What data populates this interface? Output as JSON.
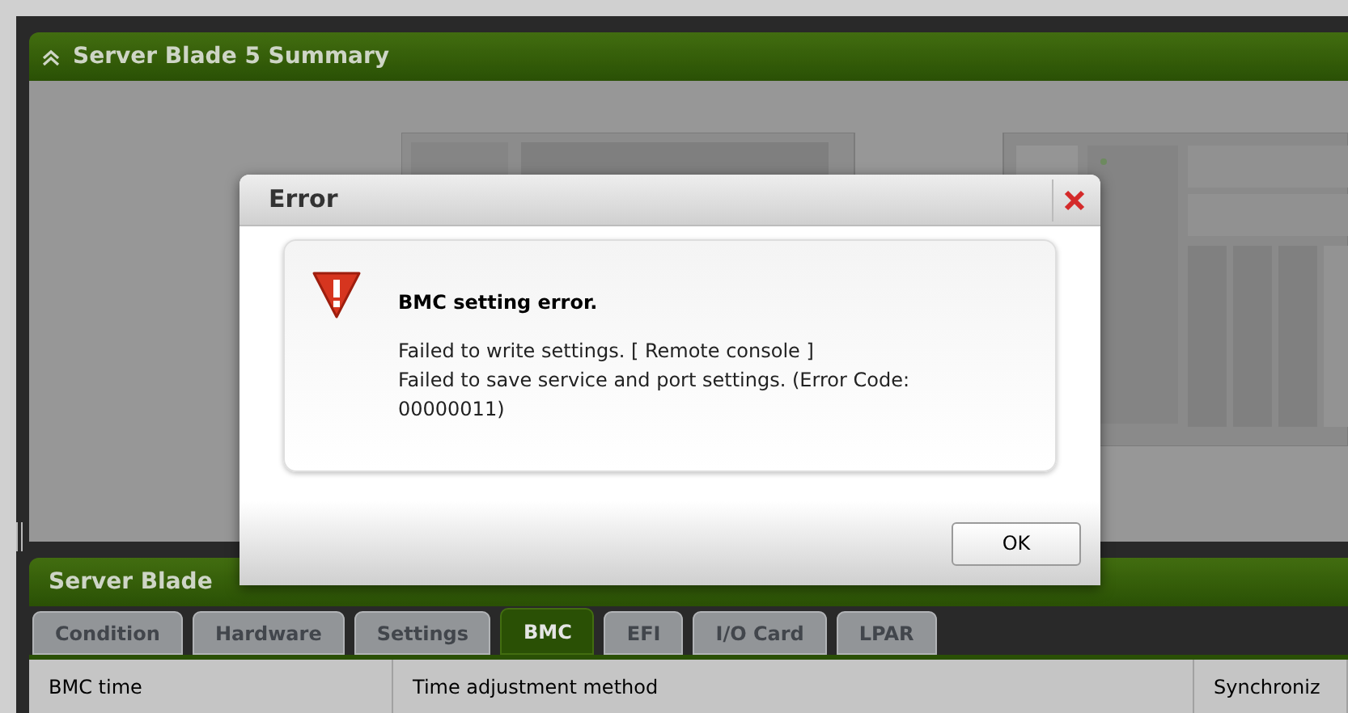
{
  "summary_panel": {
    "title": "Server Blade 5 Summary"
  },
  "info_panel": {
    "title": "Server Blade"
  },
  "tabs": [
    {
      "label": "Condition",
      "selected": false
    },
    {
      "label": "Hardware",
      "selected": false
    },
    {
      "label": "Settings",
      "selected": false
    },
    {
      "label": "BMC",
      "selected": true
    },
    {
      "label": "EFI",
      "selected": false
    },
    {
      "label": "I/O Card",
      "selected": false
    },
    {
      "label": "LPAR",
      "selected": false
    }
  ],
  "table": {
    "columns": [
      "BMC time",
      "Time adjustment method",
      "Synchroniz"
    ]
  },
  "dialog": {
    "title": "Error",
    "heading": "BMC setting error.",
    "message": [
      "Failed to write settings. [ Remote console ]",
      "Failed to save service and port settings. (Error Code: 00000011)"
    ],
    "buttons": [
      "OK"
    ]
  }
}
